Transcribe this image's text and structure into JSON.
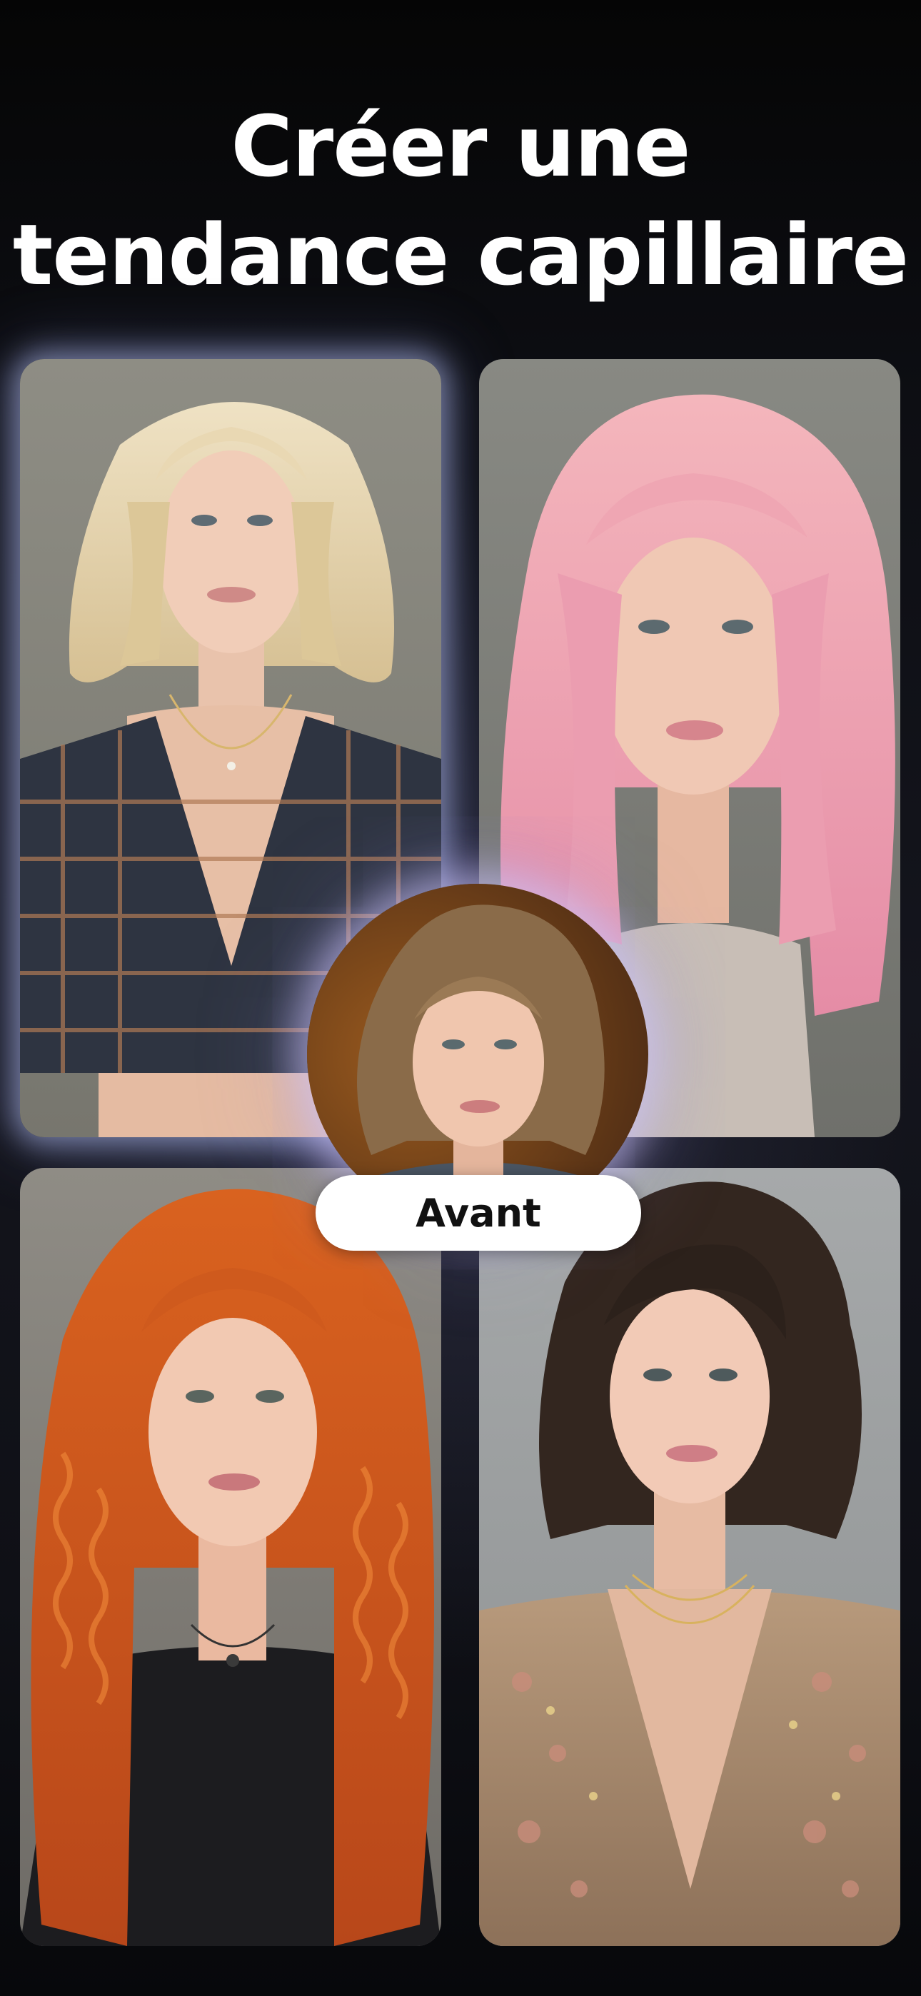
{
  "headline": {
    "line1": "Créer une",
    "line2": "tendance capillaire"
  },
  "before_badge": {
    "label": "Avant"
  },
  "colors": {
    "background": "#0b0c10",
    "title_text": "#ffffff",
    "badge_bg": "#ffffff",
    "badge_text": "#111111",
    "glow": "#bec8ff"
  },
  "styles": [
    {
      "name": "blonde-bob",
      "hair_color": "#e6d4ad"
    },
    {
      "name": "pink-waves",
      "hair_color": "#f0a6b4"
    },
    {
      "name": "red-curls",
      "hair_color": "#d2551c"
    },
    {
      "name": "brunette-bob",
      "hair_color": "#3a2a22"
    }
  ]
}
